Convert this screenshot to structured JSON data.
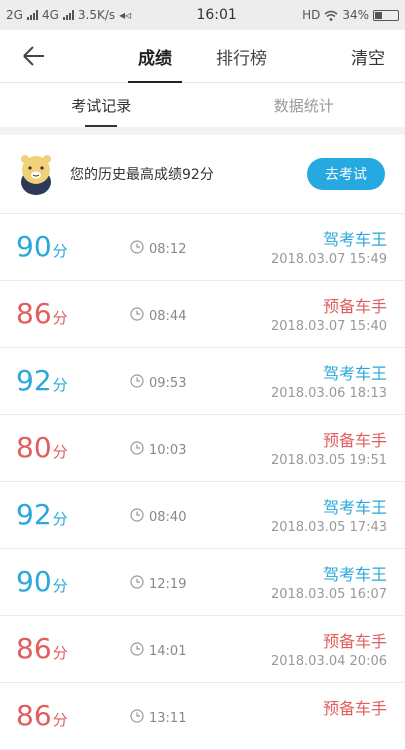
{
  "status": {
    "left": {
      "net1": "2G",
      "net2": "4G",
      "speed": "3.5K/s"
    },
    "time": "16:01",
    "right": {
      "hd": "HD",
      "battery": "34%"
    },
    "battery_level": 0.34
  },
  "nav": {
    "tabs": [
      {
        "label": "成绩"
      },
      {
        "label": "排行榜"
      }
    ],
    "clear_label": "清空"
  },
  "subtabs": [
    {
      "label": "考试记录"
    },
    {
      "label": "数据统计"
    }
  ],
  "best": {
    "text": "您的历史最高成绩92分",
    "button_label": "去考试"
  },
  "colors": {
    "pass": "#2aa7dc",
    "fail": "#e25d5d",
    "accent": "#26a9e0"
  },
  "records": [
    {
      "score": "90",
      "unit": "分",
      "duration": "08:12",
      "rank": "驾考车王",
      "datetime": "2018.03.07  15:49",
      "pass": true
    },
    {
      "score": "86",
      "unit": "分",
      "duration": "08:44",
      "rank": "预备车手",
      "datetime": "2018.03.07  15:40",
      "pass": false
    },
    {
      "score": "92",
      "unit": "分",
      "duration": "09:53",
      "rank": "驾考车王",
      "datetime": "2018.03.06  18:13",
      "pass": true
    },
    {
      "score": "80",
      "unit": "分",
      "duration": "10:03",
      "rank": "预备车手",
      "datetime": "2018.03.05  19:51",
      "pass": false
    },
    {
      "score": "92",
      "unit": "分",
      "duration": "08:40",
      "rank": "驾考车王",
      "datetime": "2018.03.05  17:43",
      "pass": true
    },
    {
      "score": "90",
      "unit": "分",
      "duration": "12:19",
      "rank": "驾考车王",
      "datetime": "2018.03.05  16:07",
      "pass": true
    },
    {
      "score": "86",
      "unit": "分",
      "duration": "14:01",
      "rank": "预备车手",
      "datetime": "2018.03.04  20:06",
      "pass": false
    },
    {
      "score": "86",
      "unit": "分",
      "duration": "13:11",
      "rank": "预备车手",
      "datetime": "",
      "pass": false
    }
  ]
}
